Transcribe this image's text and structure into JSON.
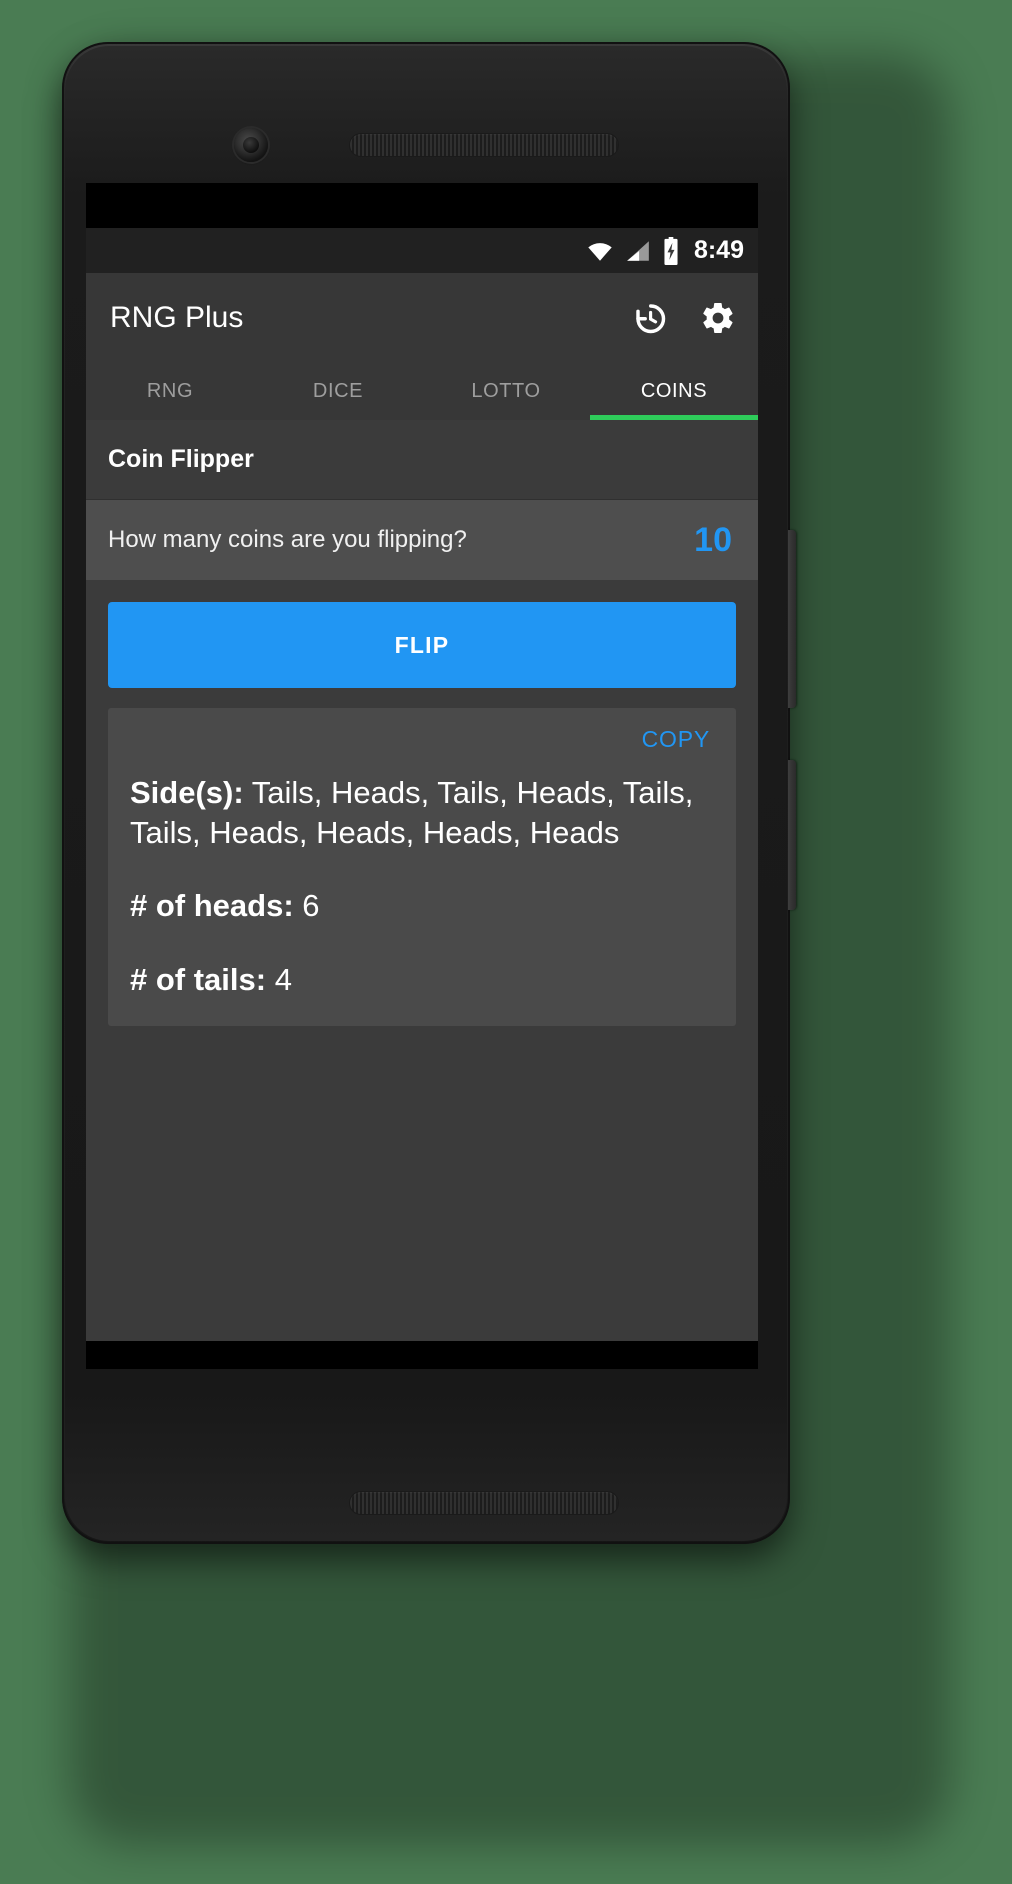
{
  "background_color": "#4a7c53",
  "device": {
    "name": "android-phone-mockup",
    "camera_icon": "front-camera-icon",
    "speaker_icon": "speaker-grille-icon",
    "volume_button": "volume-rocker",
    "power_button": "power-button"
  },
  "statusbar": {
    "wifi_icon": "wifi-icon",
    "signal_icon": "cell-signal-icon",
    "battery_icon": "battery-charging-icon",
    "time": "8:49"
  },
  "appbar": {
    "title": "RNG Plus",
    "history_icon": "history-restore-icon",
    "settings_icon": "gear-icon"
  },
  "tabs": {
    "active_index": 3,
    "active_indicator_color": "#2ecc5a",
    "items": [
      {
        "label": "RNG"
      },
      {
        "label": "DICE"
      },
      {
        "label": "LOTTO"
      },
      {
        "label": "COINS"
      }
    ]
  },
  "main": {
    "section_title": "Coin Flipper",
    "count_row": {
      "label": "How many coins are you flipping?",
      "value": "10",
      "value_color": "#2196f3"
    },
    "flip_button": {
      "label": "FLIP",
      "color": "#2196f3"
    },
    "results": {
      "copy_label": "COPY",
      "sides_label": "Side(s):",
      "sides_value": "Tails, Heads, Tails, Heads, Tails, Tails, Heads, Heads, Heads, Heads",
      "heads_label": "# of heads:",
      "heads_value": "6",
      "tails_label": "# of tails:",
      "tails_value": "4"
    }
  }
}
